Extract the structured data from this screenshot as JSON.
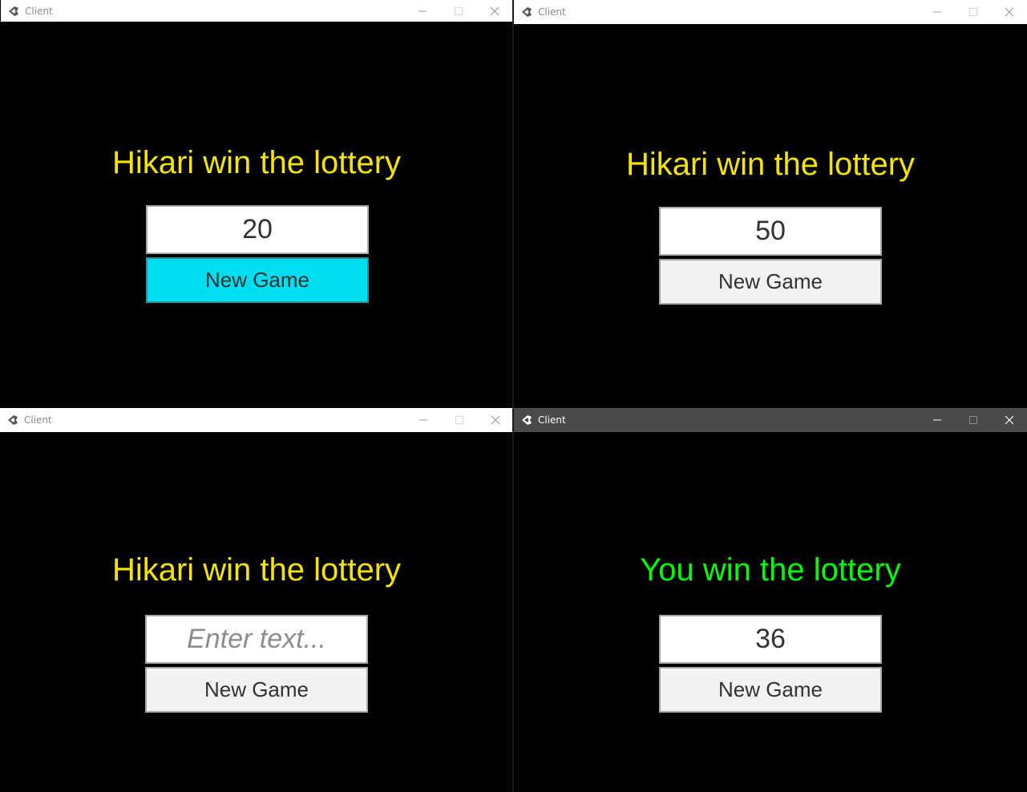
{
  "colors": {
    "heading_other": "#f5e400",
    "heading_self": "#00ff00",
    "button_hover": "#00dcf0",
    "button_normal": "#f2f2f2",
    "active_titlebar": "#4a4a4a"
  },
  "windows": [
    {
      "title": "Client",
      "active": false,
      "icon": "unity-icon",
      "heading": "Hikari win the lottery",
      "heading_color": "#f5e400",
      "input": {
        "value": "20",
        "placeholder": ""
      },
      "button": {
        "label": "New Game",
        "state": "hover"
      }
    },
    {
      "title": "Client",
      "active": false,
      "icon": "unity-icon",
      "heading": "Hikari win the lottery",
      "heading_color": "#f5e400",
      "input": {
        "value": "50",
        "placeholder": ""
      },
      "button": {
        "label": "New Game",
        "state": "normal"
      }
    },
    {
      "title": "Client",
      "active": false,
      "icon": "unity-icon",
      "heading": "Hikari win the lottery",
      "heading_color": "#f5e400",
      "input": {
        "value": "",
        "placeholder": "Enter text..."
      },
      "button": {
        "label": "New Game",
        "state": "normal"
      }
    },
    {
      "title": "Client",
      "active": true,
      "icon": "unity-icon",
      "heading": "You win the lottery",
      "heading_color": "#00ff00",
      "input": {
        "value": "36",
        "placeholder": ""
      },
      "button": {
        "label": "New Game",
        "state": "normal"
      }
    }
  ]
}
